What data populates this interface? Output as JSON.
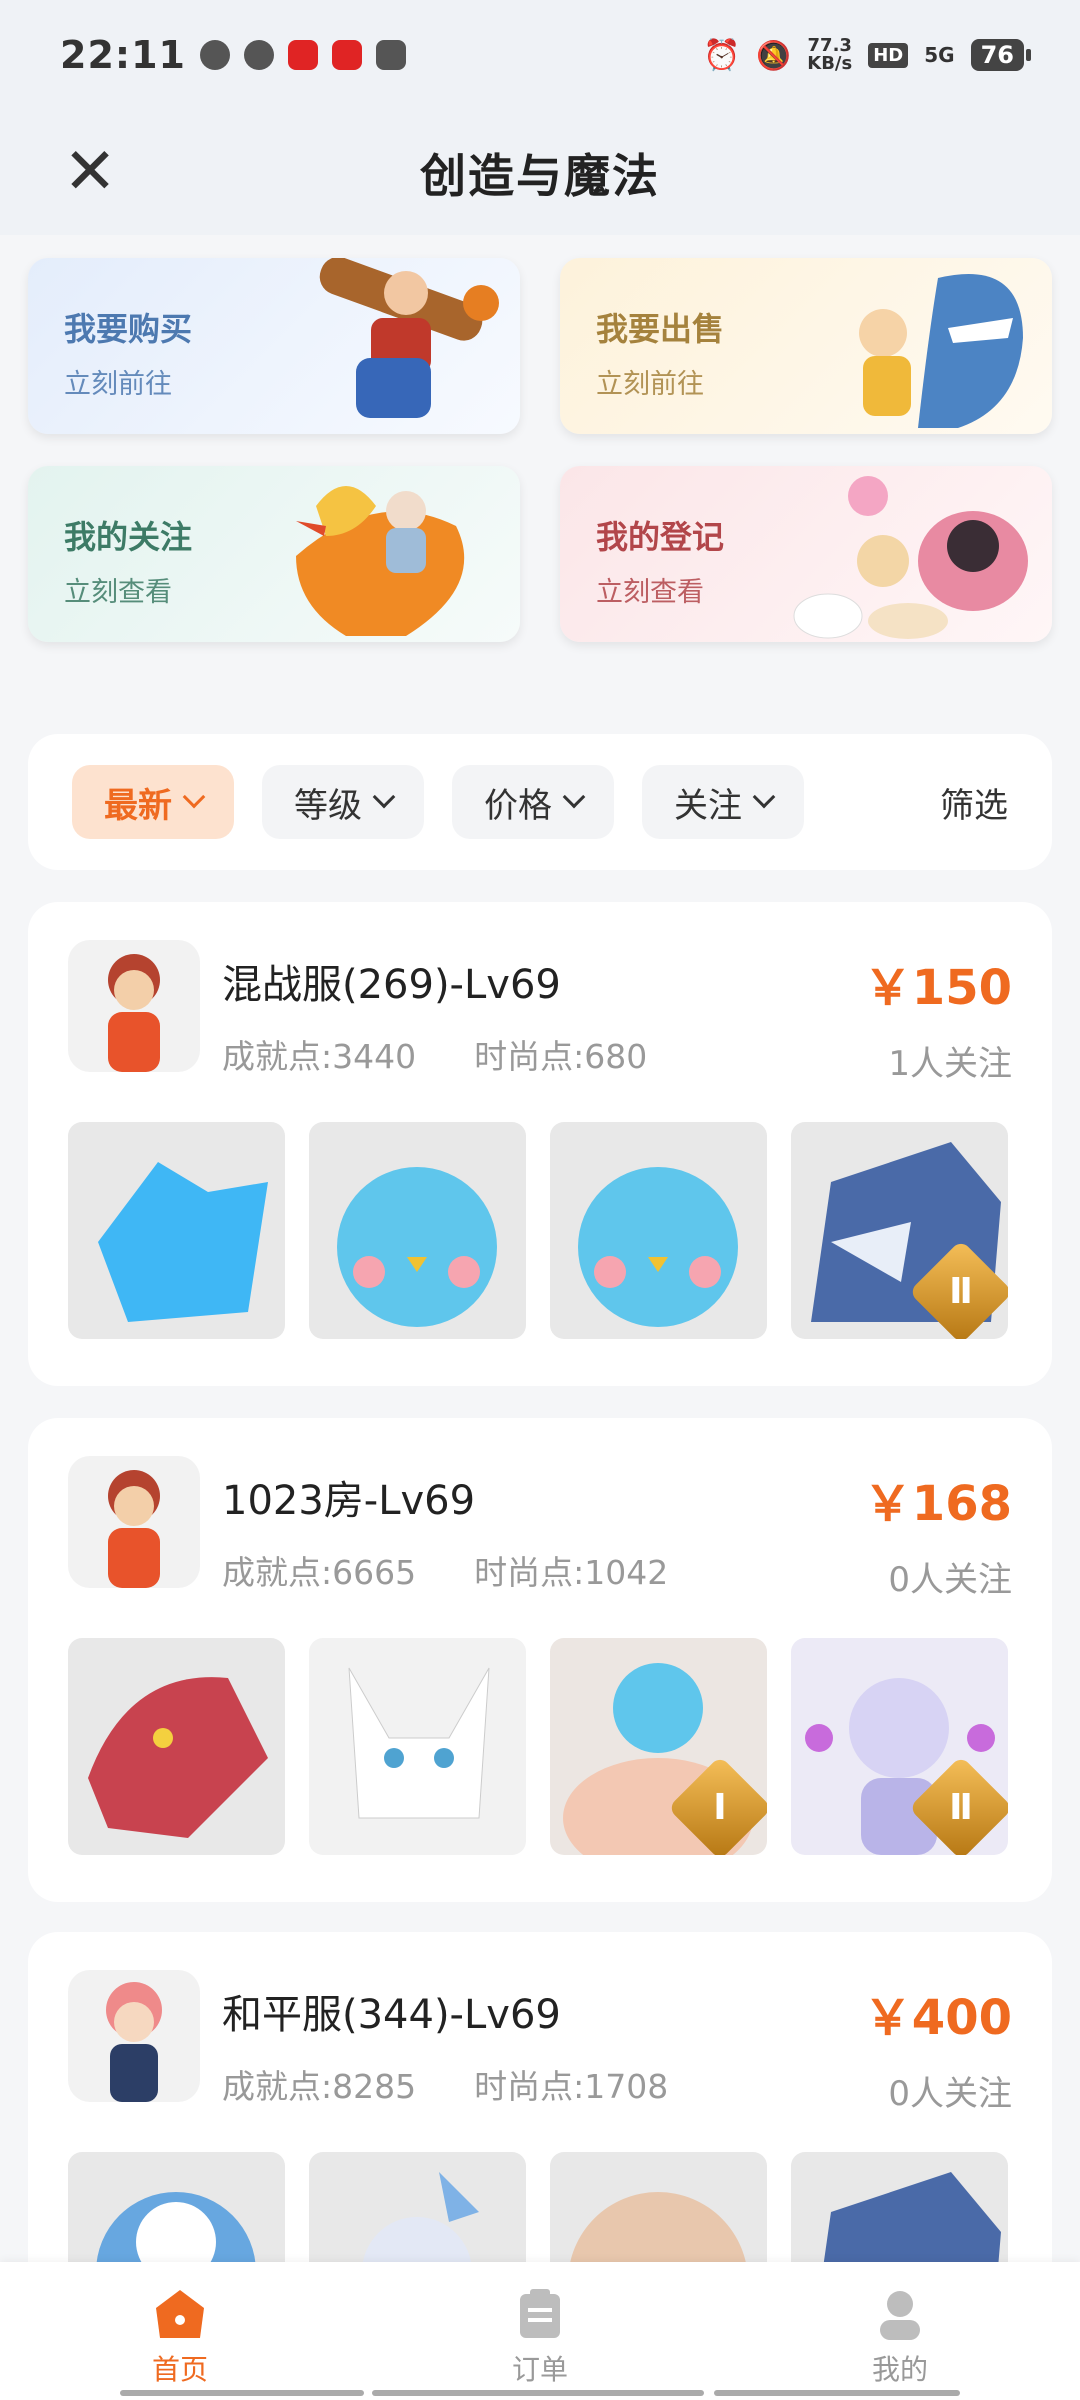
{
  "status_bar": {
    "time": "22:11",
    "speed_value": "77.3",
    "speed_unit": "KB/s",
    "hd": "HD",
    "signal": "5G",
    "battery": "76"
  },
  "header": {
    "title": "创造与魔法",
    "close_glyph": "✕"
  },
  "features": [
    {
      "title": "我要购买",
      "subtitle": "立刻前往"
    },
    {
      "title": "我要出售",
      "subtitle": "立刻前往"
    },
    {
      "title": "我的关注",
      "subtitle": "立刻查看"
    },
    {
      "title": "我的登记",
      "subtitle": "立刻查看"
    }
  ],
  "filters": {
    "items": [
      "最新",
      "等级",
      "价格",
      "关注"
    ],
    "active": "最新",
    "screen": "筛选"
  },
  "listings": [
    {
      "name": "混战服(269)-Lv69",
      "achievement": "成就点:3440",
      "fashion": "时尚点:680",
      "price": "￥150",
      "followers": "1人关注",
      "items": [
        {
          "color": "#3fb7f5",
          "badge": ""
        },
        {
          "color": "#5fc6ec",
          "badge": ""
        },
        {
          "color": "#5fc6ec",
          "badge": ""
        },
        {
          "color": "#4a6aa8",
          "badge": "II"
        }
      ]
    },
    {
      "name": "1023房-Lv69",
      "achievement": "成就点:6665",
      "fashion": "时尚点:1042",
      "price": "￥168",
      "followers": "0人关注",
      "items": [
        {
          "color": "#c8434f",
          "badge": ""
        },
        {
          "color": "#eeeeee",
          "badge": ""
        },
        {
          "color": "#f3c8b3",
          "badge": "I"
        },
        {
          "color": "#d7d3f4",
          "badge": "II"
        }
      ]
    },
    {
      "name": "和平服(344)-Lv69",
      "achievement": "成就点:8285",
      "fashion": "时尚点:1708",
      "price": "￥400",
      "followers": "0人关注",
      "items": [
        {
          "color": "#67a7e0",
          "badge": ""
        },
        {
          "color": "#eef1f7",
          "badge": ""
        },
        {
          "color": "#e8c7ad",
          "badge": ""
        },
        {
          "color": "#4a6aa8",
          "badge": ""
        }
      ]
    }
  ],
  "bottom_nav": [
    {
      "label": "首页",
      "icon": "home-icon",
      "active": true
    },
    {
      "label": "订单",
      "icon": "order-icon",
      "active": false
    },
    {
      "label": "我的",
      "icon": "profile-icon",
      "active": false
    }
  ],
  "colors": {
    "accent": "#ef6a20",
    "header_bg": "#eff2f6"
  }
}
